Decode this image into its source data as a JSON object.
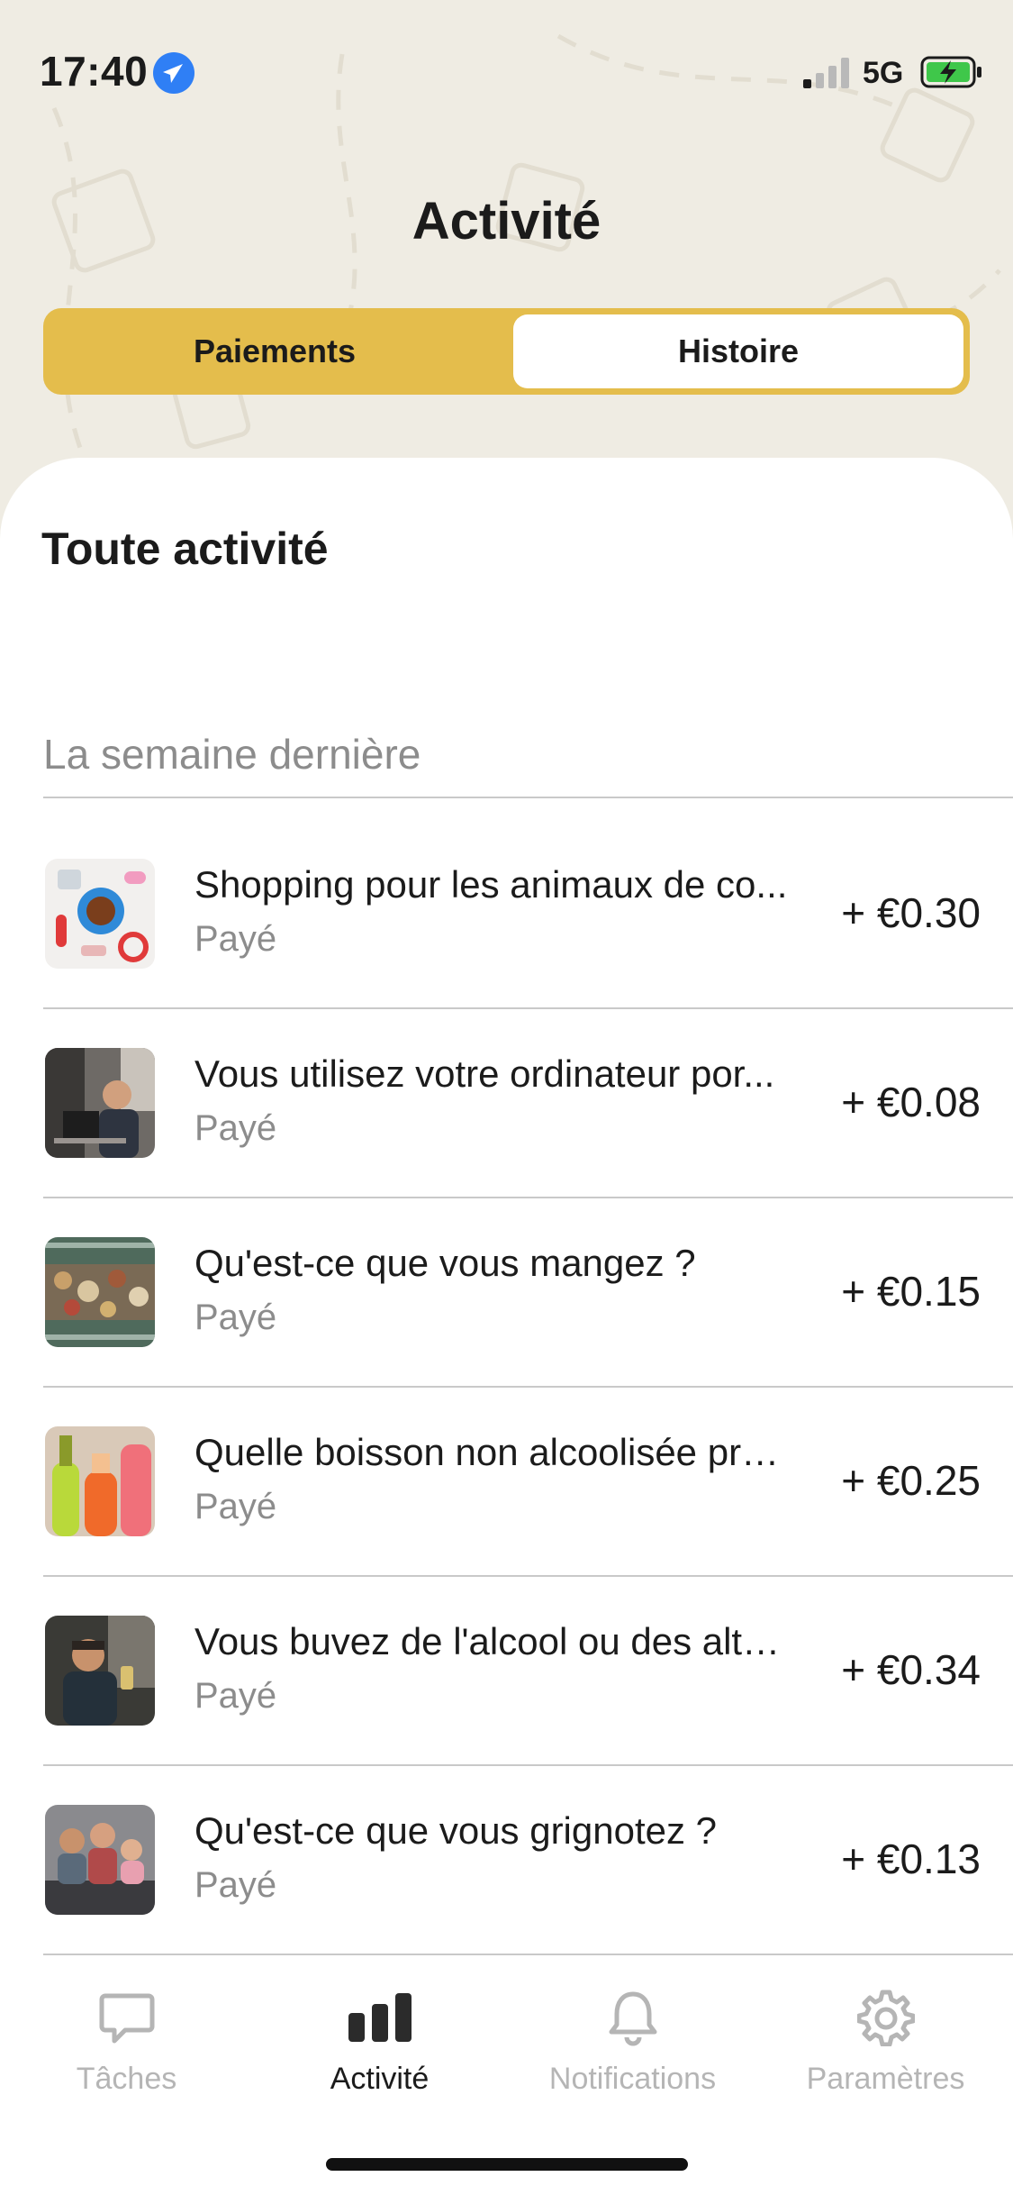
{
  "status_bar": {
    "time": "17:40",
    "network": "5G"
  },
  "header": {
    "title": "Activité"
  },
  "segmented": {
    "left_label": "Paiements",
    "right_label": "Histoire"
  },
  "content": {
    "section_title": "Toute activité",
    "week_label": "La semaine dernière",
    "items": [
      {
        "title": "Shopping pour les animaux de co...",
        "status": "Payé",
        "amount": "+ €0.30",
        "thumb": "pet-supplies"
      },
      {
        "title": "Vous utilisez votre ordinateur por...",
        "status": "Payé",
        "amount": "+ €0.08",
        "thumb": "man-at-computer"
      },
      {
        "title": "Qu'est-ce que vous mangez ?",
        "status": "Payé",
        "amount": "+ €0.15",
        "thumb": "food-table"
      },
      {
        "title": "Quelle boisson non alcoolisée pre...",
        "status": "Payé",
        "amount": "+ €0.25",
        "thumb": "colored-drinks"
      },
      {
        "title": "Vous buvez de l'alcool ou des alte...",
        "status": "Payé",
        "amount": "+ €0.34",
        "thumb": "man-with-drink"
      },
      {
        "title": "Qu'est-ce que vous grignotez ?",
        "status": "Payé",
        "amount": "+ €0.13",
        "thumb": "family-snack"
      }
    ]
  },
  "tabs": [
    {
      "label": "Tâches",
      "icon": "chat-bubble-icon",
      "active": false
    },
    {
      "label": "Activité",
      "icon": "bar-chart-icon",
      "active": true
    },
    {
      "label": "Notifications",
      "icon": "bell-icon",
      "active": false
    },
    {
      "label": "Paramètres",
      "icon": "gear-icon",
      "active": false
    }
  ],
  "colors": {
    "accent": "#e4bd4c",
    "background": "#efece3",
    "muted_text": "#8c8c8c"
  }
}
